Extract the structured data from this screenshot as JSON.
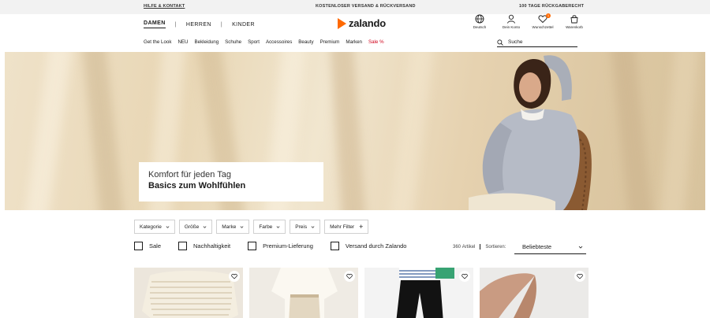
{
  "topbar": {
    "help": "HILFE & KONTAKT",
    "shipping": "KOSTENLOSER VERSAND & RÜCKVERSAND",
    "returns": "100 TAGE RÜCKGABERECHT"
  },
  "header": {
    "genders": [
      "DAMEN",
      "HERREN",
      "KINDER"
    ],
    "logo": "zalando",
    "account": {
      "language": "Deutsch",
      "profile": "Dein Konto",
      "wishlist": "Wunschzettel",
      "wishlist_count": "1",
      "cart": "Warenkorb"
    },
    "categories": [
      "Get the Look",
      "NEU",
      "Bekleidung",
      "Schuhe",
      "Sport",
      "Accessoires",
      "Beauty",
      "Premium",
      "Marken"
    ],
    "sale": "Sale %",
    "search_placeholder": "Suche"
  },
  "hero": {
    "line1": "Komfort für jeden Tag",
    "line2": "Basics zum Wohlfühlen"
  },
  "filters": {
    "category": "Kategorie",
    "size": "Größe",
    "brand": "Marke",
    "color": "Farbe",
    "price": "Preis",
    "more": "Mehr Filter"
  },
  "checks": {
    "sale": "Sale",
    "sustainability": "Nachhaltigkeit",
    "premium_delivery": "Premium-Lieferung",
    "zalando_shipping": "Versand durch Zalando"
  },
  "results": {
    "count": "360",
    "count_label": "Artikel",
    "sort_label": "Sortieren:",
    "sort_value": "Beliebteste"
  },
  "colors": {
    "accent": "#ff6900",
    "sale": "#d0021b"
  }
}
